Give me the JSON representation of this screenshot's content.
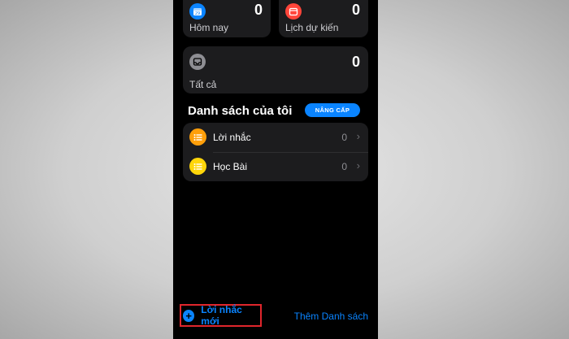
{
  "smart_lists": {
    "today": {
      "label": "Hôm nay",
      "count": "0",
      "icon": "calendar-icon",
      "icon_text": "29",
      "color": "#0a84ff"
    },
    "scheduled": {
      "label": "Lịch dự kiến",
      "count": "0",
      "icon": "calendar-icon",
      "color": "#ff453a"
    },
    "all": {
      "label": "Tất cả",
      "count": "0",
      "icon": "tray-icon",
      "color": "#8e8e93"
    }
  },
  "my_lists": {
    "title": "Danh sách của tôi",
    "upgrade_label": "NÂNG CẤP",
    "items": [
      {
        "name": "Lời nhắc",
        "count": "0",
        "icon": "list-icon",
        "color": "#ff9f0a"
      },
      {
        "name": "Học Bài",
        "count": "0",
        "icon": "list-icon",
        "color": "#ffd60a"
      }
    ]
  },
  "toolbar": {
    "new_reminder_label": "Lời nhắc mới",
    "add_list_label": "Thêm Danh sách",
    "accent": "#0a84ff",
    "highlight_color": "#e0262c"
  }
}
